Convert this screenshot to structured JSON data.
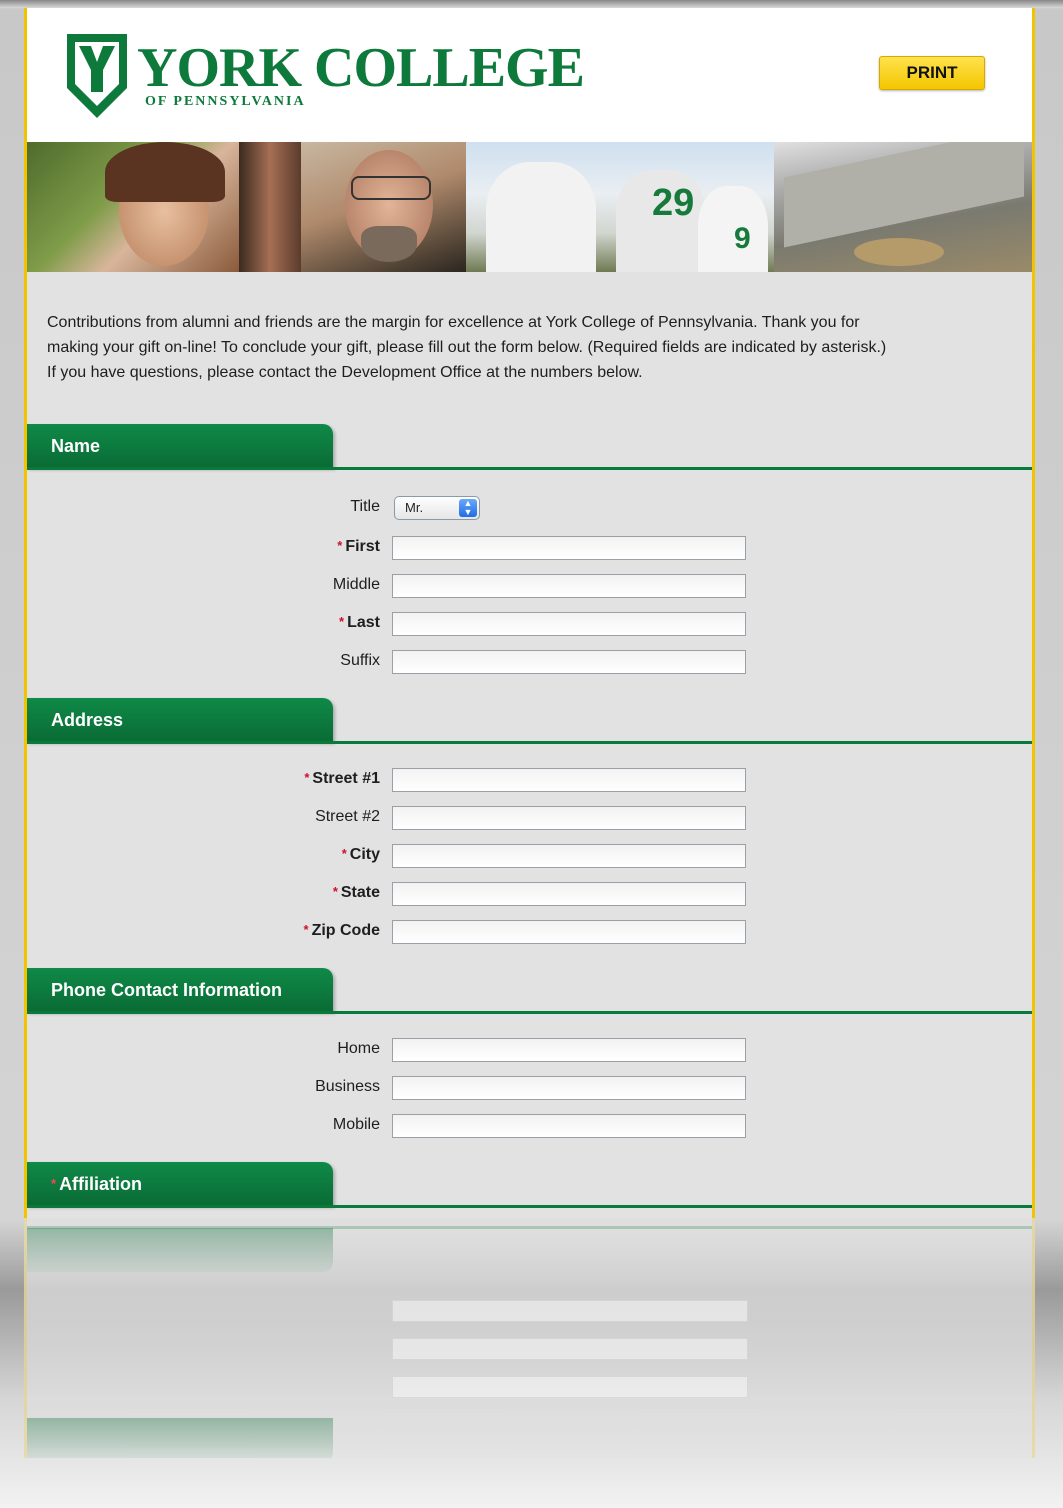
{
  "header": {
    "college_name": "YORK COLLEGE",
    "college_sub": "OF PENNSYLVANIA",
    "print_label": "PRINT"
  },
  "colors": {
    "brand_green": "#0a7a3c",
    "accent_yellow": "#f4c600",
    "required_red": "#d0102a"
  },
  "intro_text": "Contributions from alumni and friends are the margin for excellence at York College of Pennsylvania. Thank you for making your gift on-line! To conclude your gift, please fill out the form below. (Required fields are indicated by asterisk.) If you have questions, please contact the Development Office at the numbers below.",
  "name_section": {
    "title": "Name",
    "title_label": "Title",
    "title_value": "Mr.",
    "first": "First",
    "middle": "Middle",
    "last": "Last",
    "suffix": "Suffix"
  },
  "address_section": {
    "title": "Address",
    "street1": "Street #1",
    "street2": "Street #2",
    "city": "City",
    "state": "State",
    "zip": "Zip Code"
  },
  "phone_section": {
    "title": "Phone Contact Information",
    "home": "Home",
    "business": "Business",
    "mobile": "Mobile"
  },
  "affiliation_section": {
    "title": "Affiliation"
  },
  "required_mark": "*"
}
